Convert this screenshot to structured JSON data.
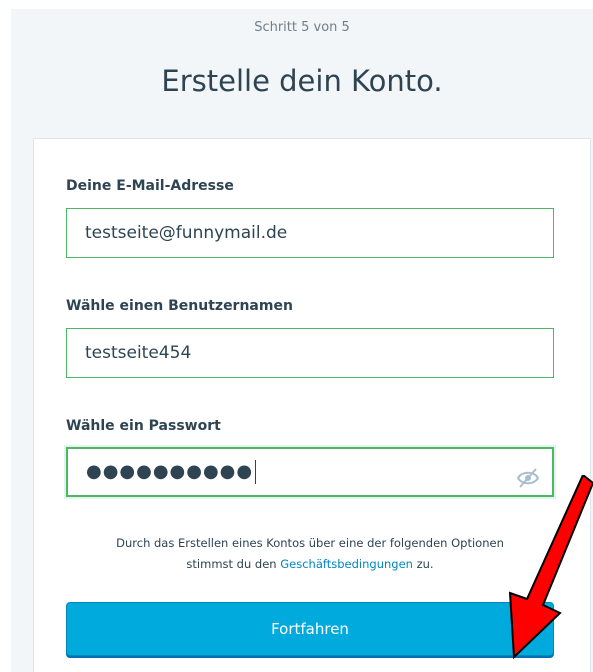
{
  "header": {
    "step_text": "Schritt 5 von 5",
    "title": "Erstelle dein Konto."
  },
  "form": {
    "email": {
      "label": "Deine E-Mail-Adresse",
      "value": "testseite@funnymail.de"
    },
    "username": {
      "label": "Wähle einen Benutzernamen",
      "value": "testseite454"
    },
    "password": {
      "label": "Wähle ein Passwort",
      "masked_value": "●●●●●●●●●●",
      "toggle_icon": "eye-slash-icon"
    }
  },
  "terms": {
    "line1": "Durch das Erstellen eines Kontos über eine der folgenden Optionen",
    "line2_prefix": "stimmst du den ",
    "link_text": "Geschäftsbedingungen",
    "line2_suffix": " zu."
  },
  "submit": {
    "label": "Fortfahren"
  },
  "annotation": {
    "icon": "red-arrow-icon",
    "color": "#ff0000"
  },
  "colors": {
    "accent": "#00aadc",
    "valid_border": "#4ab866",
    "link": "#0087be",
    "text": "#2e4453"
  }
}
